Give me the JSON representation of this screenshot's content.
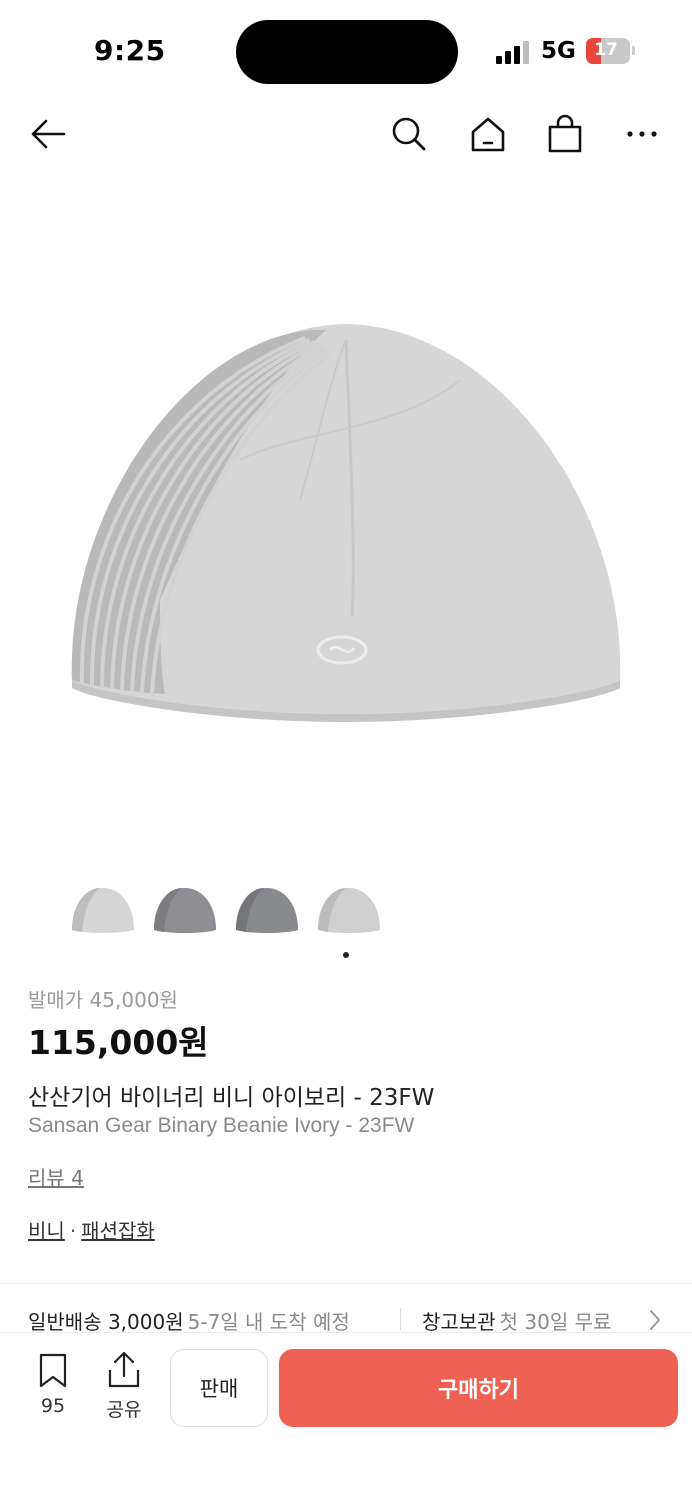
{
  "status_bar": {
    "time": "9:25",
    "network": "5G",
    "battery_level": "17",
    "battery_color": "#e8453c"
  },
  "nav": {
    "icons": [
      "back-arrow-icon",
      "search-icon",
      "home-icon",
      "shopping-bag-icon",
      "more-icon"
    ]
  },
  "gallery": {
    "thumbnail_count": 4,
    "current_page": 1,
    "thumbnail_colors": [
      "#d5d5d5",
      "#8f8f93",
      "#898a8e",
      "#cfcfcf"
    ]
  },
  "product": {
    "release_price": "발매가 45,000원",
    "price": "115,000원",
    "title_ko": "산산기어 바이너리 비니 아이보리 - 23FW",
    "title_en": "Sansan Gear Binary Beanie Ivory - 23FW",
    "review_label": "리뷰 4",
    "categories": [
      "비니",
      "패션잡화"
    ]
  },
  "shipping": {
    "standard_label": "일반배송 3,000원",
    "standard_eta": "5-7일 내 도착 예정",
    "warehouse_label": "창고보관",
    "warehouse_note": "첫 30일 무료"
  },
  "actions": {
    "bookmark_count": "95",
    "share_label": "공유",
    "sell_label": "판매",
    "buy_label": "구매하기",
    "buy_color": "#ef6253"
  }
}
